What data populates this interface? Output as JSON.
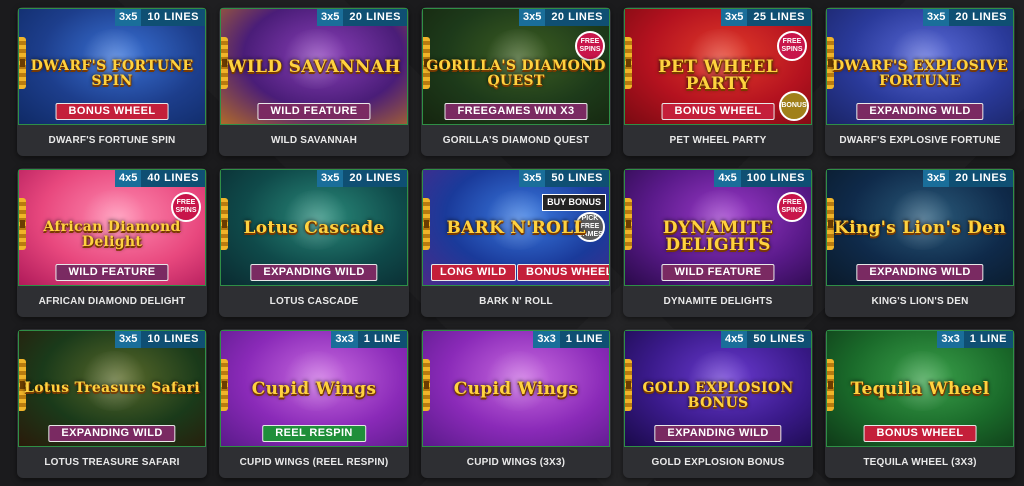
{
  "games": [
    {
      "id": "dwarfs-fortune-spin",
      "name": "DWARF'S FORTUNE SPIN",
      "reels": "3x5",
      "lines": "10 LINES",
      "title": "DWARF'S FORTUNE SPIN",
      "features": [
        "BONUS WHEEL"
      ],
      "feature_color": "red",
      "bg": [
        "#1d3e8c",
        "#3a72d6",
        "#0f2a66"
      ]
    },
    {
      "id": "wild-savannah",
      "name": "WILD SAVANNAH",
      "reels": "3x5",
      "lines": "20 LINES",
      "title": "WILD SAVANNAH",
      "features": [
        "WILD FEATURE"
      ],
      "feature_color": "plum",
      "bg": [
        "#4a1d78",
        "#8a3fb8",
        "#b06a2a"
      ]
    },
    {
      "id": "gorillas-diamond-quest",
      "name": "GORILLA'S DIAMOND QUEST",
      "reels": "3x5",
      "lines": "20 LINES",
      "title": "GORILLA'S DIAMOND QUEST",
      "features": [
        "FREEGAMES WIN X3"
      ],
      "feature_color": "plum",
      "badge": "FREE SPINS",
      "bg": [
        "#1d3a1a",
        "#3d5e22",
        "#15250f"
      ]
    },
    {
      "id": "pet-wheel-party",
      "name": "PET WHEEL PARTY",
      "reels": "3x5",
      "lines": "25 LINES",
      "title": "PET WHEEL PARTY",
      "features": [
        "BONUS WHEEL"
      ],
      "feature_color": "red",
      "badge": "FREE SPINS",
      "badge2": "BONUS",
      "bg": [
        "#b4121f",
        "#e23b2a",
        "#7a0a12"
      ]
    },
    {
      "id": "dwarfs-explosive-fortune",
      "name": "DWARF'S EXPLOSIVE FORTUNE",
      "reels": "3x5",
      "lines": "20 LINES",
      "title": "DWARF'S EXPLOSIVE FORTUNE",
      "features": [
        "EXPANDING WILD"
      ],
      "feature_color": "plum",
      "bg": [
        "#2a3a9a",
        "#5a6ad8",
        "#1a2466"
      ]
    },
    {
      "id": "african-diamond-delight",
      "name": "AFRICAN DIAMOND DELIGHT",
      "reels": "4x5",
      "lines": "40 LINES",
      "title": "African Diamond Delight",
      "features": [
        "WILD FEATURE"
      ],
      "feature_color": "plum",
      "badge": "FREE SPINS",
      "bg": [
        "#e8487e",
        "#ff8ab0",
        "#b01a5a"
      ]
    },
    {
      "id": "lotus-cascade",
      "name": "LOTUS CASCADE",
      "reels": "3x5",
      "lines": "20 LINES",
      "title": "Lotus Cascade",
      "features": [
        "EXPANDING WILD"
      ],
      "feature_color": "plum",
      "bg": [
        "#0f4a4a",
        "#2a8a7a",
        "#0a2a30"
      ]
    },
    {
      "id": "bark-n-roll",
      "name": "BARK N' ROLL",
      "reels": "3x5",
      "lines": "50 LINES",
      "title": "BARK N'ROLL",
      "features": [
        "LONG WILD",
        "BONUS WHEEL"
      ],
      "feature_color": "red",
      "buy_bonus": "BUY BONUS",
      "badge": "PICK FREE GAMES",
      "bg": [
        "#1a3a9a",
        "#3a7ae0",
        "#4a2a8a"
      ]
    },
    {
      "id": "dynamite-delights",
      "name": "DYNAMITE DELIGHTS",
      "reels": "4x5",
      "lines": "100 LINES",
      "title": "DYNAMITE DELIGHTS",
      "features": [
        "WILD FEATURE"
      ],
      "feature_color": "plum",
      "badge": "FREE SPINS",
      "bg": [
        "#5a1a8a",
        "#9a3ac8",
        "#2a0a4a"
      ]
    },
    {
      "id": "kings-lions-den",
      "name": "KING'S LION'S DEN",
      "reels": "3x5",
      "lines": "20 LINES",
      "title": "King's Lion's Den",
      "features": [
        "EXPANDING WILD"
      ],
      "feature_color": "plum",
      "bg": [
        "#0f2a4a",
        "#2a5a7a",
        "#0a1a2a"
      ]
    },
    {
      "id": "lotus-treasure-safari",
      "name": "LOTUS TREASURE SAFARI",
      "reels": "3x5",
      "lines": "10 LINES",
      "title": "Lotus Treasure Safari",
      "features": [
        "EXPANDING WILD"
      ],
      "feature_color": "plum",
      "bg": [
        "#1a3a1a",
        "#5a6a2a",
        "#2a1a0a"
      ]
    },
    {
      "id": "cupid-wings-reel-respin",
      "name": "CUPID WINGS (REEL RESPIN)",
      "reels": "3x3",
      "lines": "1 LINE",
      "title": "Cupid Wings",
      "features": [
        "REEL RESPIN"
      ],
      "feature_color": "green",
      "bg": [
        "#8a2ab8",
        "#c86ae0",
        "#5a1a8a"
      ]
    },
    {
      "id": "cupid-wings-3x3",
      "name": "CUPID WINGS (3X3)",
      "reels": "3x3",
      "lines": "1 LINE",
      "title": "Cupid Wings",
      "features": [],
      "feature_color": "plum",
      "bg": [
        "#8a2ab8",
        "#c86ae0",
        "#5a1a8a"
      ]
    },
    {
      "id": "gold-explosion-bonus",
      "name": "GOLD EXPLOSION BONUS",
      "reels": "4x5",
      "lines": "50 LINES",
      "title": "GOLD EXPLOSION BONUS",
      "features": [
        "EXPANDING WILD"
      ],
      "feature_color": "plum",
      "bg": [
        "#3a1a8a",
        "#6a3ad0",
        "#1a0a4a"
      ]
    },
    {
      "id": "tequila-wheel-3x3",
      "name": "TEQUILA WHEEL (3X3)",
      "reels": "3x3",
      "lines": "1 LINE",
      "title": "Tequila Wheel",
      "features": [
        "BONUS WHEEL"
      ],
      "feature_color": "red",
      "bg": [
        "#1a6a2a",
        "#3aa04a",
        "#0f3a18"
      ]
    }
  ]
}
